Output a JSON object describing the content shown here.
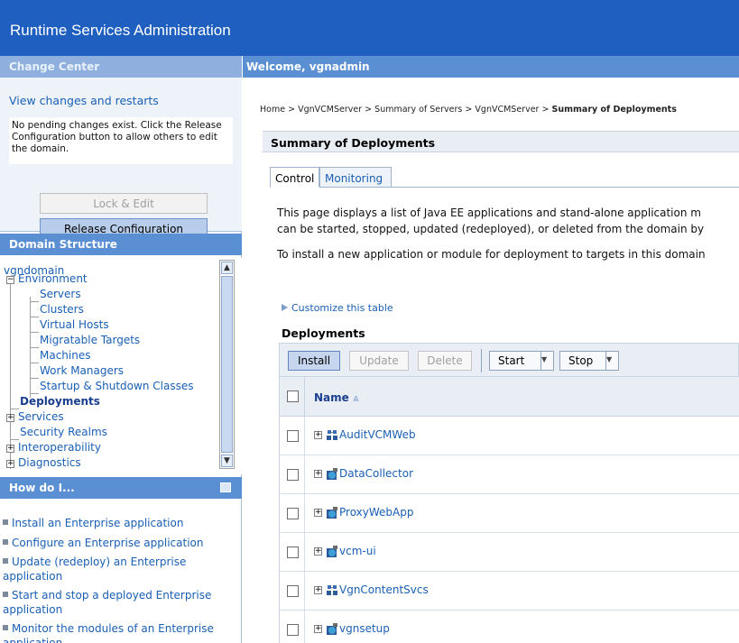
{
  "app": {
    "title": "Runtime Services Administration"
  },
  "change_center": {
    "header": "Change Center",
    "link": "View changes and restarts",
    "message": "No pending changes exist. Click the Release Configuration button to allow others to edit the domain.",
    "lock_edit_label": "Lock & Edit",
    "release_label": "Release Configuration"
  },
  "domain_structure": {
    "header": "Domain Structure",
    "items": [
      {
        "label": "vgndomain"
      },
      {
        "label": "Environment"
      },
      {
        "label": "Servers"
      },
      {
        "label": "Clusters"
      },
      {
        "label": "Virtual Hosts"
      },
      {
        "label": "Migratable Targets"
      },
      {
        "label": "Machines"
      },
      {
        "label": "Work Managers"
      },
      {
        "label": "Startup & Shutdown Classes"
      },
      {
        "label": "Deployments"
      },
      {
        "label": "Services"
      },
      {
        "label": "Security Realms"
      },
      {
        "label": "Interoperability"
      },
      {
        "label": "Diagnostics"
      }
    ]
  },
  "howdo": {
    "header": "How do I...",
    "items": [
      {
        "label": "Install an Enterprise application"
      },
      {
        "label": "Configure an Enterprise application"
      },
      {
        "label": "Update (redeploy) an Enterprise application"
      },
      {
        "label": "Start and stop a deployed Enterprise application"
      },
      {
        "label": "Monitor the modules of an Enterprise application"
      }
    ]
  },
  "main": {
    "welcome": "Welcome, vgnadmin",
    "breadcrumb": {
      "parts": [
        "Home",
        "VgnVCMServer",
        "Summary of Servers",
        "VgnVCMServer"
      ],
      "current": "Summary of Deployments",
      "separator": ">"
    },
    "section_title": "Summary of Deployments",
    "tabs": [
      {
        "label": "Control",
        "active": true
      },
      {
        "label": "Monitoring",
        "active": false
      }
    ],
    "desc_line1": "This page displays a list of Java EE applications and stand-alone application m",
    "desc_line2": "can be started, stopped, updated (redeployed), or deleted from the domain by",
    "desc_line3": "To install a new application or module for deployment to targets in this domain",
    "customize_link": "Customize this table",
    "deployments_title": "Deployments",
    "toolbar": {
      "install": "Install",
      "update": "Update",
      "delete": "Delete",
      "start": "Start",
      "stop": "Stop"
    },
    "table": {
      "name_header": "Name",
      "sort_glyph": "≈",
      "rows": [
        {
          "name": "AuditVCMWeb",
          "icon": "enterprise-app-icon"
        },
        {
          "name": "DataCollector",
          "icon": "web-app-icon"
        },
        {
          "name": "ProxyWebApp",
          "icon": "web-app-icon"
        },
        {
          "name": "vcm-ui",
          "icon": "web-app-icon"
        },
        {
          "name": "VgnContentSvcs",
          "icon": "enterprise-app-icon"
        },
        {
          "name": "vgnsetup",
          "icon": "web-app-icon"
        }
      ]
    }
  }
}
